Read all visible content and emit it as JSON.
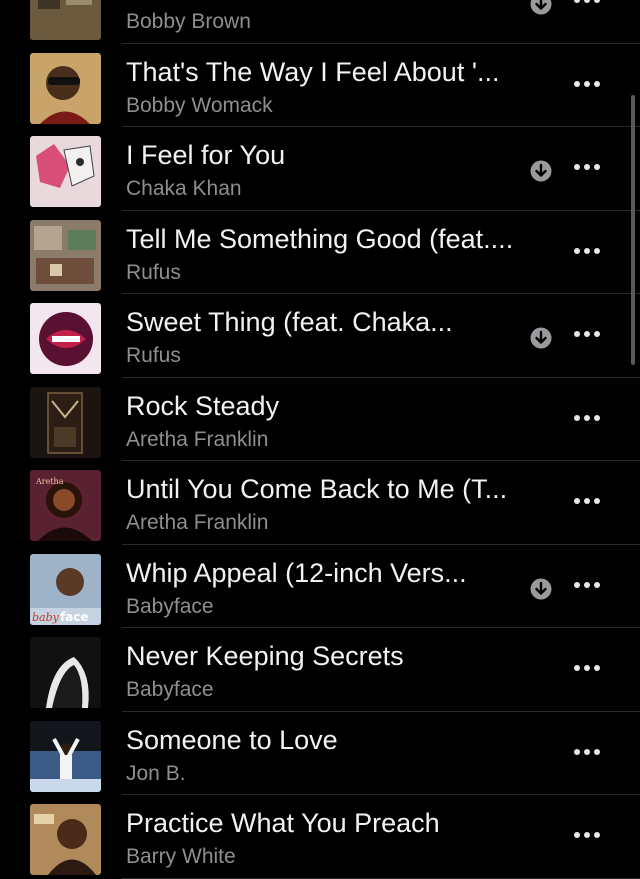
{
  "songs": [
    {
      "title": "",
      "artist": "Bobby Brown",
      "downloaded": true,
      "art": "bobby-brown-cover",
      "artColor": "#6b5a3e"
    },
    {
      "title": "That's The Way I Feel About '...",
      "artist": "Bobby Womack",
      "downloaded": false,
      "art": "bobby-womack-cover",
      "artColor": "#c9a46a"
    },
    {
      "title": "I Feel for You",
      "artist": "Chaka Khan",
      "downloaded": true,
      "art": "chaka-khan-cover",
      "artColor": "#e9d8dc"
    },
    {
      "title": "Tell Me Something Good (feat....",
      "artist": "Rufus",
      "downloaded": false,
      "art": "rufus-cover-1",
      "artColor": "#8a7b6a"
    },
    {
      "title": "Sweet Thing (feat. Chaka...",
      "artist": "Rufus",
      "downloaded": true,
      "art": "rufus-cover-2",
      "artColor": "#f4e6ee"
    },
    {
      "title": "Rock Steady",
      "artist": "Aretha Franklin",
      "downloaded": false,
      "art": "aretha-cover-1",
      "artColor": "#1b1410"
    },
    {
      "title": "Until You Come Back to Me (T...",
      "artist": "Aretha Franklin",
      "downloaded": false,
      "art": "aretha-cover-2",
      "artColor": "#5a2230"
    },
    {
      "title": "Whip Appeal (12-inch Vers...",
      "artist": "Babyface",
      "downloaded": true,
      "art": "babyface-cover-1",
      "artColor": "#9fb3c8"
    },
    {
      "title": "Never Keeping Secrets",
      "artist": "Babyface",
      "downloaded": false,
      "art": "babyface-cover-2",
      "artColor": "#111111"
    },
    {
      "title": "Someone to Love",
      "artist": "Jon B.",
      "downloaded": false,
      "art": "jon-b-cover",
      "artColor": "#3b5a86"
    },
    {
      "title": "Practice What You Preach",
      "artist": "Barry White",
      "downloaded": false,
      "art": "barry-white-cover",
      "artColor": "#b08a5a"
    }
  ],
  "icons": {
    "download": "download-arrow-icon",
    "more": "more-ellipsis-icon"
  }
}
